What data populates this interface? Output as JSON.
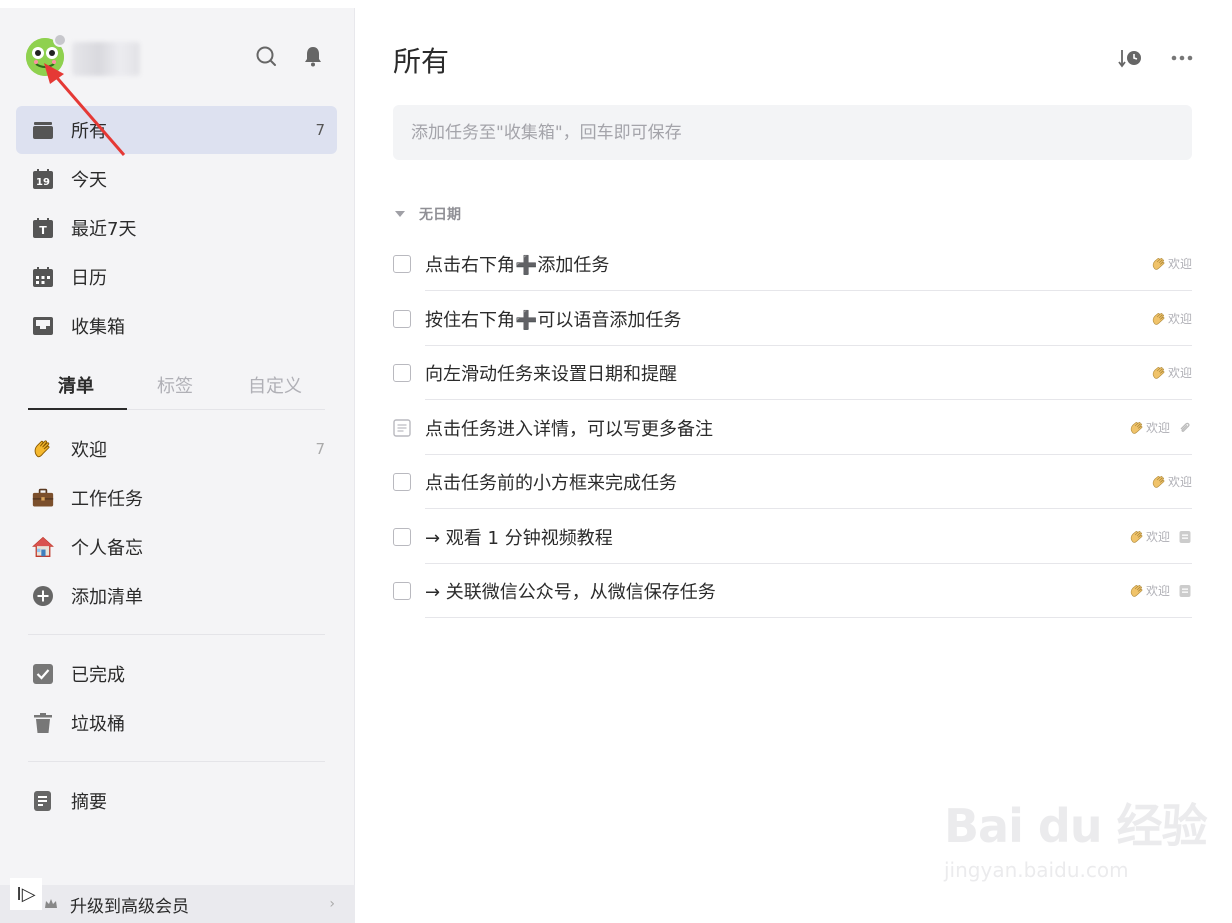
{
  "sidebar": {
    "user_name": "",
    "nav": [
      {
        "label": "所有",
        "count": "7",
        "icon": "inbox-stack-icon"
      },
      {
        "label": "今天",
        "icon": "calendar-19-icon"
      },
      {
        "label": "最近7天",
        "icon": "calendar-t-icon"
      },
      {
        "label": "日历",
        "icon": "calendar-grid-icon"
      },
      {
        "label": "收集箱",
        "icon": "inbox-tray-icon"
      }
    ],
    "tabs": [
      "清单",
      "标签",
      "自定义"
    ],
    "lists": [
      {
        "label": "欢迎",
        "count": "7",
        "icon": "waving-hand-icon"
      },
      {
        "label": "工作任务",
        "icon": "briefcase-icon"
      },
      {
        "label": "个人备忘",
        "icon": "house-icon"
      },
      {
        "label": "添加清单",
        "icon": "plus-circle-icon"
      }
    ],
    "system": [
      {
        "label": "已完成",
        "icon": "check-square-icon"
      },
      {
        "label": "垃圾桶",
        "icon": "trash-icon"
      }
    ],
    "summary": {
      "label": "摘要",
      "icon": "summary-doc-icon"
    },
    "upgrade_label": "升级到高级会员",
    "collapse_glyph": "I▷"
  },
  "main": {
    "title": "所有",
    "add_placeholder": "添加任务至\"收集箱\"，回车即可保存",
    "section_label": "无日期",
    "tasks": [
      {
        "title": "点击右下角➕添加任务",
        "list": "欢迎"
      },
      {
        "title": "按住右下角➕可以语音添加任务",
        "list": "欢迎"
      },
      {
        "title": "向左滑动任务来设置日期和提醒",
        "list": "欢迎"
      },
      {
        "title": "点击任务进入详情，可以写更多备注",
        "list": "欢迎"
      },
      {
        "title": "点击任务前的小方框来完成任务",
        "list": "欢迎"
      },
      {
        "title": "→ 观看 1 分钟视频教程",
        "list": "欢迎"
      },
      {
        "title": "→ 关联微信公众号，从微信保存任务",
        "list": "欢迎"
      }
    ]
  },
  "watermark": {
    "main": "Bai du 经验",
    "sub": "jingyan.baidu.com"
  },
  "colors": {
    "accent_active_bg": "#dde1f0",
    "sidebar_bg": "#f4f4f6",
    "annotation_arrow": "#e53935"
  }
}
